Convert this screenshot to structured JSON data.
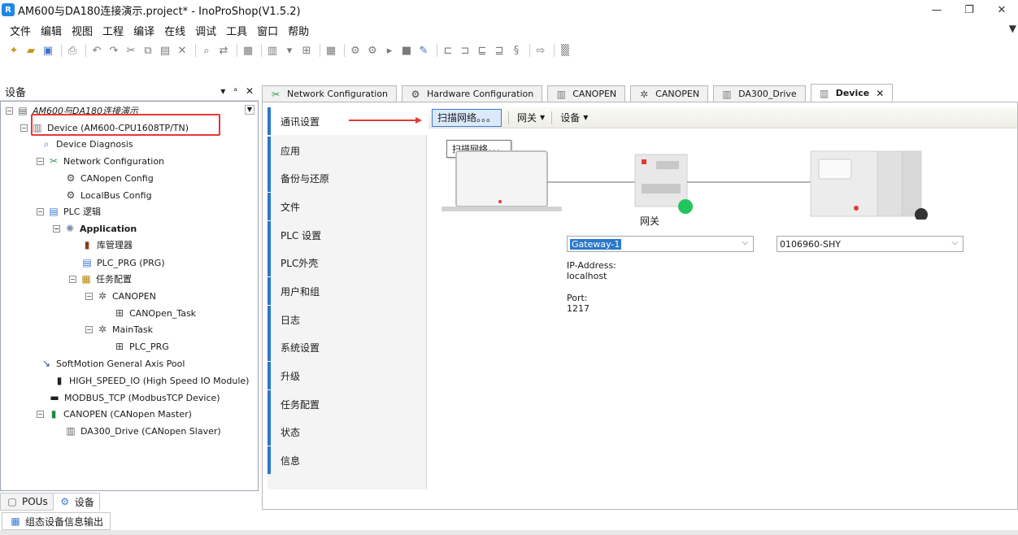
{
  "title_bar": {
    "title": "AM600与DA180连接演示.project* - InoProShop(V1.5.2)",
    "app_icon": "R",
    "minimize": "—",
    "maximize": "❐",
    "close": "✕"
  },
  "menu": [
    "文件",
    "编辑",
    "视图",
    "工程",
    "编译",
    "在线",
    "调试",
    "工具",
    "窗口",
    "帮助"
  ],
  "devices_panel": {
    "title": "设备",
    "tools": [
      "▾",
      "ᵃ",
      "✕"
    ],
    "tree": [
      {
        "label": "AM600与DA180连接演示",
        "icon": "project-icon"
      },
      {
        "label": "Device (AM600-CPU1608TP/TN)",
        "icon": "device-icon"
      },
      {
        "label": "Device Diagnosis",
        "icon": "diagnosis-icon"
      },
      {
        "label": "Network Configuration",
        "icon": "network-config-icon"
      },
      {
        "label": "CANopen Config",
        "icon": "canopen-config-icon"
      },
      {
        "label": "LocalBus Config",
        "icon": "localbus-config-icon"
      },
      {
        "label": "PLC 逻辑",
        "icon": "plc-logic-icon"
      },
      {
        "label": "Application",
        "icon": "application-icon"
      },
      {
        "label": "库管理器",
        "icon": "library-manager-icon"
      },
      {
        "label": "PLC_PRG (PRG)",
        "icon": "program-icon"
      },
      {
        "label": "任务配置",
        "icon": "task-config-icon"
      },
      {
        "label": "CANOPEN",
        "icon": "task-icon"
      },
      {
        "label": "CANOpen_Task",
        "icon": "task-call-icon"
      },
      {
        "label": "MainTask",
        "icon": "task-icon"
      },
      {
        "label": "PLC_PRG",
        "icon": "task-call-icon"
      },
      {
        "label": "SoftMotion General Axis Pool",
        "icon": "axis-pool-icon"
      },
      {
        "label": "HIGH_SPEED_IO (High Speed IO Module)",
        "icon": "io-module-icon"
      },
      {
        "label": "MODBUS_TCP (ModbusTCP Device)",
        "icon": "modbus-icon"
      },
      {
        "label": "CANOPEN (CANopen Master)",
        "icon": "canopen-master-icon"
      },
      {
        "label": "DA300_Drive (CANopen Slaver)",
        "icon": "slave-drive-icon"
      }
    ]
  },
  "bottom_tabs": [
    "POUs",
    "设备"
  ],
  "output_tab": "组态设备信息输出",
  "doc_tabs": [
    {
      "label": "Network Configuration",
      "icon": "network-config-icon"
    },
    {
      "label": "Hardware Configuration",
      "icon": "hardware-config-icon"
    },
    {
      "label": "CANOPEN",
      "icon": "device-icon"
    },
    {
      "label": "CANOPEN",
      "icon": "task-icon"
    },
    {
      "label": "DA300_Drive",
      "icon": "device-icon"
    },
    {
      "label": "Device",
      "icon": "device-icon"
    }
  ],
  "doc_tab_close": "✕",
  "side_nav": [
    "通讯设置",
    "应用",
    "备份与还原",
    "文件",
    "PLC 设置",
    "PLC外壳",
    "用户和组",
    "日志",
    "系统设置",
    "升级",
    "任务配置",
    "状态",
    "信息"
  ],
  "comm_toolbar": {
    "scan": "扫描网络。。。",
    "gateway": "网关",
    "device": "设备",
    "tooltip": "扫描网络。。。"
  },
  "gateway": {
    "label": "网关",
    "name": "Gateway-1",
    "ip_label": "IP-Address:",
    "ip": "localhost",
    "port_label": "Port:",
    "port": "1217",
    "status_color": "#22c55e"
  },
  "device_target": {
    "name": "0106960-SHY",
    "status_color": "#333333"
  },
  "colors": {
    "accent": "#2b78c9",
    "highlight": "#e53935"
  }
}
